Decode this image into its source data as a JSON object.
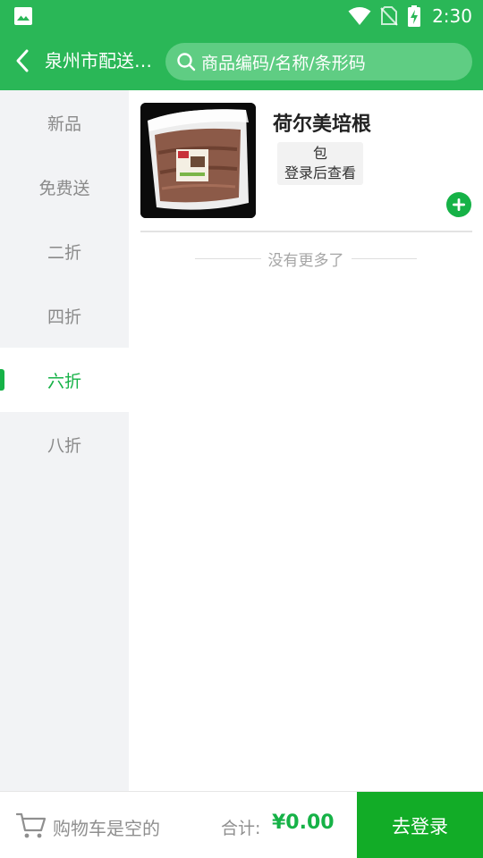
{
  "status_bar": {
    "time": "2:30",
    "icons": [
      "gallery-icon",
      "wifi-icon",
      "no-sim-icon",
      "battery-charging-icon"
    ]
  },
  "header": {
    "city": "泉州市配送…",
    "search_placeholder": "商品编码/名称/条形码",
    "icons": [
      "back-icon",
      "search-icon"
    ]
  },
  "sidebar": {
    "items": [
      {
        "label": "新品",
        "active": false
      },
      {
        "label": "免费送",
        "active": false
      },
      {
        "label": "二折",
        "active": false
      },
      {
        "label": "四折",
        "active": false
      },
      {
        "label": "六折",
        "active": true
      },
      {
        "label": "八折",
        "active": false
      }
    ]
  },
  "products": [
    {
      "name": "荷尔美培根",
      "unit": "包",
      "price_hint": "登录后查看",
      "image": "packaged-bacon-photo",
      "add_icon": "plus-circle-icon"
    }
  ],
  "list_end_text": "没有更多了",
  "bottom_bar": {
    "cart_text": "购物车是空的",
    "total_label": "合计:",
    "total_value": "¥0.00",
    "login_label": "去登录",
    "cart_icon": "cart-icon"
  },
  "colors": {
    "brand_green": "#2ab757",
    "accent_green": "#16b247",
    "button_green": "#12ac27",
    "sidebar_bg": "#f2f3f5"
  }
}
